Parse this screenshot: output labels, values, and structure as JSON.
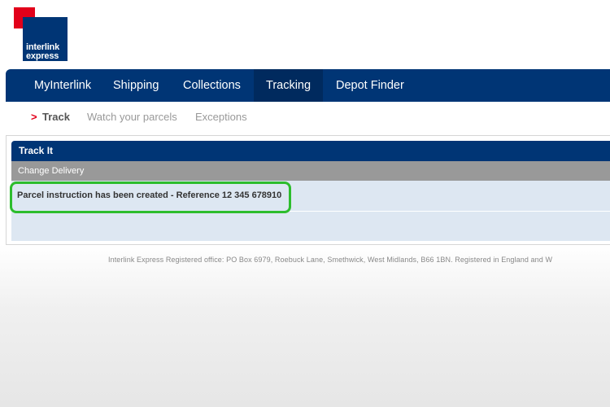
{
  "logo": {
    "line1": "interlink",
    "line2": "express"
  },
  "nav": {
    "items": [
      "MyInterlink",
      "Shipping",
      "Collections",
      "Tracking",
      "Depot Finder"
    ],
    "active": "Tracking"
  },
  "subnav": {
    "marker": ">",
    "current": "Track",
    "links": [
      "Watch your parcels",
      "Exceptions"
    ]
  },
  "panel": {
    "header": "Track It",
    "section": "Change Delivery",
    "message": "Parcel instruction has been created - Reference 12 345 678910"
  },
  "footer": {
    "text": "Interlink Express Registered office: PO Box 6979, Roebuck Lane, Smethwick, West Midlands, B66 1BN. Registered in England and W"
  },
  "colors": {
    "brand_blue": "#003575",
    "brand_red": "#e2001a",
    "highlight": "#2dbd2d"
  }
}
